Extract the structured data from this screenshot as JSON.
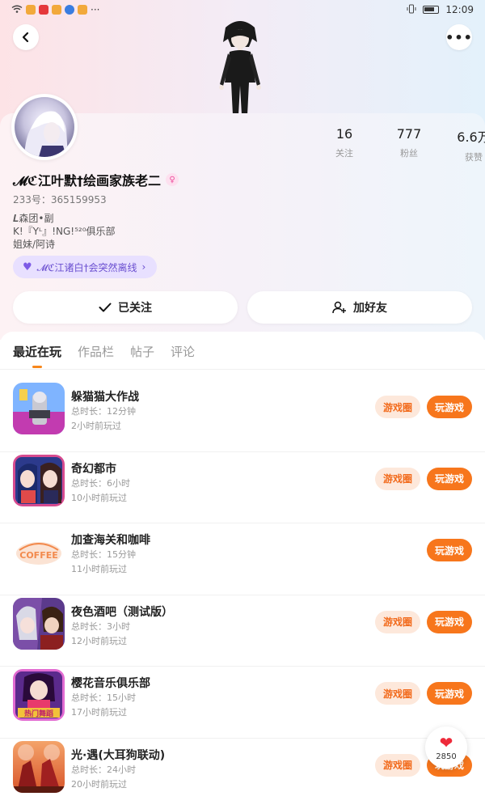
{
  "status_bar": {
    "time": "12:09"
  },
  "profile": {
    "following_count": "16",
    "following_label": "关注",
    "fans_count": "777",
    "fans_label": "粉丝",
    "likes_count": "6.6万",
    "likes_label": "获赞",
    "username": "𝓜ℭ江叶默†绘画家族老二",
    "uid": "233号：365159953",
    "bio": [
      "𝑳森团•副",
      "K!『Yᴸ』!NG!⁵²⁰俱乐部",
      "姐妹/阿诗"
    ],
    "relation_tag": "𝓜ℭ江诸白†会突然离线",
    "followed_label": "已关注",
    "add_friend_label": "加好友"
  },
  "tabs": [
    "最近在玩",
    "作品栏",
    "帖子",
    "评论"
  ],
  "game_row": {
    "circle_label": "游戏圈",
    "play_label": "玩游戏"
  },
  "games": [
    {
      "title": "躲猫猫大作战",
      "duration": "总时长：12分钟",
      "last_played": "2小时前玩过",
      "has_circle": true
    },
    {
      "title": "奇幻都市",
      "duration": "总时长：6小时",
      "last_played": "10小时前玩过",
      "has_circle": true
    },
    {
      "title": "加查海关和咖啡",
      "duration": "总时长：15分钟",
      "last_played": "11小时前玩过",
      "has_circle": false,
      "icon_text": "COFFEE"
    },
    {
      "title": "夜色酒吧（测试版）",
      "duration": "总时长：3小时",
      "last_played": "12小时前玩过",
      "has_circle": true
    },
    {
      "title": "樱花音乐俱乐部",
      "duration": "总时长：15小时",
      "last_played": "17小时前玩过",
      "has_circle": true,
      "icon_text": "热门舞蹈"
    },
    {
      "title": "光·遇(大耳狗联动)",
      "duration": "总时长：24小时",
      "last_played": "20小时前玩过",
      "has_circle": true
    }
  ],
  "like_count": "2850",
  "colors": {
    "accent": "#f7761c",
    "circle_bg": "#fde8db",
    "tag_bg": "#e8e0ff"
  }
}
